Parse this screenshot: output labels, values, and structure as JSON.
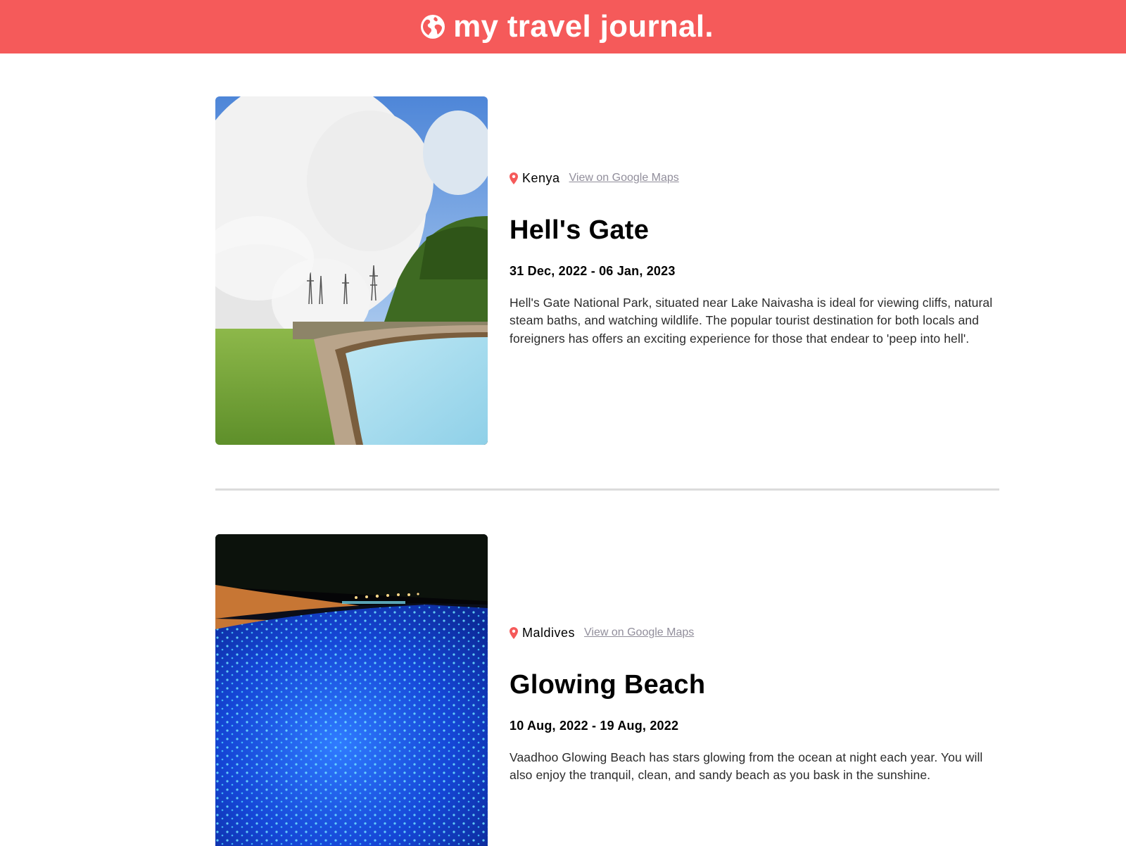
{
  "header": {
    "title": "my travel journal.",
    "icon": "globe-icon",
    "background": "#F55A5A"
  },
  "entries": [
    {
      "location": "Kenya",
      "maps_link": "View on Google Maps",
      "title": "Hell's Gate",
      "dates": "31 Dec, 2022 - 06 Jan, 2023",
      "description": "Hell's Gate National Park, situated near Lake Naivasha is ideal for viewing cliffs, natural steam baths, and watching wildlife. The popular tourist destination for both locals and foreigners has offers an exciting experience for those that endear to 'peep into hell'."
    },
    {
      "location": "Maldives",
      "maps_link": "View on Google Maps",
      "title": "Glowing Beach",
      "dates": "10 Aug, 2022 - 19 Aug, 2022",
      "description": "Vaadhoo Glowing Beach has stars glowing from the ocean at night each year. You will also enjoy the tranquil, clean, and sandy beach as you bask in the sunshine."
    }
  ],
  "colors": {
    "accent": "#F55A5A",
    "link": "#918E9B",
    "divider": "#DCDCDC"
  }
}
